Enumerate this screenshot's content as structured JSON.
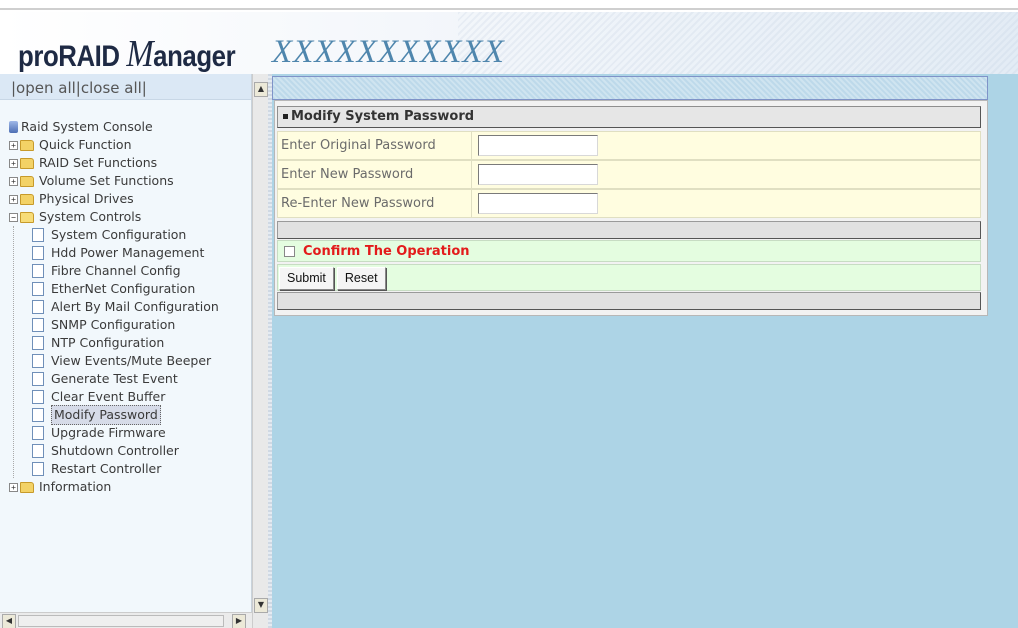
{
  "header": {
    "logo_pre": "proRAID ",
    "logo_m": "M",
    "logo_post": "anager",
    "model": "XXXXXXXXXXX"
  },
  "left": {
    "open_all": "|open all",
    "close_all": "|close all|",
    "tree": {
      "root": "Raid System Console",
      "folders": [
        {
          "label": "Quick Function"
        },
        {
          "label": "RAID Set Functions"
        },
        {
          "label": "Volume Set Functions"
        },
        {
          "label": "Physical Drives"
        },
        {
          "label": "System Controls"
        },
        {
          "label": "Information"
        }
      ],
      "system_controls_children": [
        "System Configuration",
        "Hdd Power Management",
        "Fibre Channel Config",
        "EtherNet Configuration",
        "Alert By Mail Configuration",
        "SNMP Configuration",
        "NTP Configuration",
        "View Events/Mute Beeper",
        "Generate Test Event",
        "Clear Event Buffer",
        "Modify Password",
        "Upgrade Firmware",
        "Shutdown Controller",
        "Restart Controller"
      ],
      "selected": "Modify Password"
    }
  },
  "form": {
    "title": "Modify System Password",
    "fields": [
      {
        "label": "Enter Original Password",
        "value": ""
      },
      {
        "label": "Enter New Password",
        "value": ""
      },
      {
        "label": "Re-Enter New Password",
        "value": ""
      }
    ],
    "confirm_label": "Confirm The Operation",
    "confirm_checked": false,
    "submit_label": "Submit",
    "reset_label": "Reset"
  },
  "colors": {
    "right_bg": "#add4e6",
    "form_row_bg": "#fffde0",
    "confirm_bg": "#e4fde0",
    "confirm_text": "#e31b1b",
    "model_text": "#4f86ad"
  }
}
